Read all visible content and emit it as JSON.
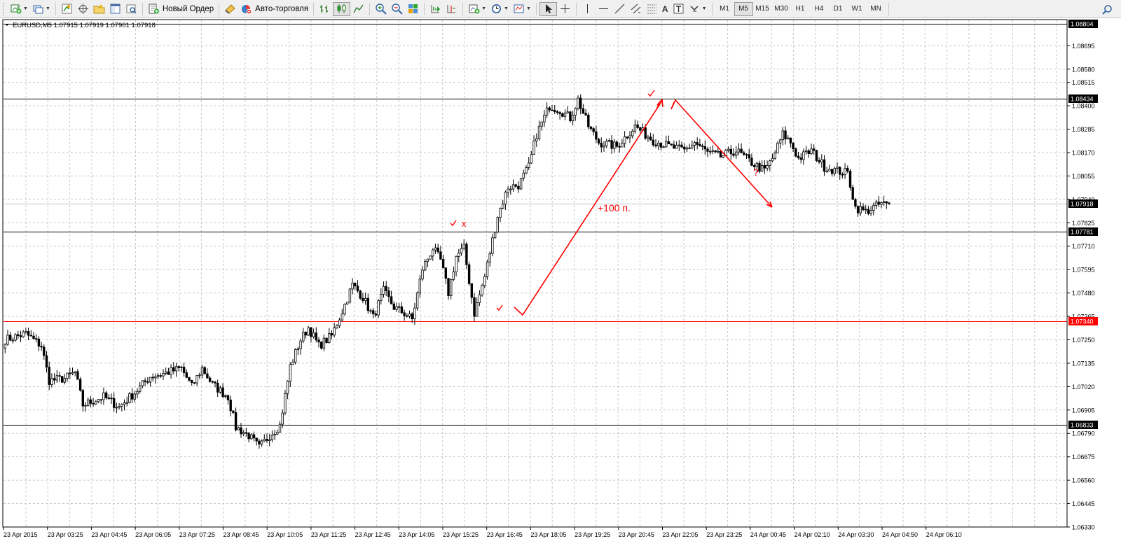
{
  "toolbar": {
    "new_order_label": "Новый Ордер",
    "auto_trading_label": "Авто-торговля",
    "timeframes": [
      "M1",
      "M5",
      "M15",
      "M30",
      "H1",
      "H4",
      "D1",
      "W1",
      "MN"
    ],
    "active_timeframe": "M5",
    "letter_tool": "A"
  },
  "chart_data": {
    "type": "candlestick",
    "symbol_info": "EURUSD,M5  1.07915 1.07919 1.07901 1.07918",
    "ylim": [
      1.0633,
      1.0882
    ],
    "price_ticks": [
      "1.08695",
      "1.08580",
      "1.08515",
      "1.08400",
      "1.08285",
      "1.08170",
      "1.08055",
      "1.07940",
      "1.07825",
      "1.07710",
      "1.07595",
      "1.07480",
      "1.07365",
      "1.07250",
      "1.07135",
      "1.07020",
      "1.06905",
      "1.06790",
      "1.06675",
      "1.06560",
      "1.06445",
      "1.06330"
    ],
    "time_labels": [
      "23 Apr 2015",
      "23 Apr 03:25",
      "23 Apr 04:45",
      "23 Apr 06:05",
      "23 Apr 07:25",
      "23 Apr 08:45",
      "23 Apr 10:05",
      "23 Apr 11:25",
      "23 Apr 12:45",
      "23 Apr 14:05",
      "23 Apr 15:25",
      "23 Apr 16:45",
      "23 Apr 18:05",
      "23 Apr 19:25",
      "23 Apr 20:45",
      "23 Apr 22:05",
      "23 Apr 23:25",
      "24 Apr 00:45",
      "24 Apr 02:10",
      "24 Apr 03:30",
      "24 Apr 04:50",
      "24 Apr 06:10"
    ],
    "close_anchors": [
      [
        0,
        1.0725
      ],
      [
        8,
        1.0728
      ],
      [
        14,
        1.0722
      ],
      [
        17,
        1.0705
      ],
      [
        23,
        1.0706
      ],
      [
        27,
        1.0709
      ],
      [
        30,
        1.0693
      ],
      [
        38,
        1.0697
      ],
      [
        44,
        1.0692
      ],
      [
        50,
        1.0699
      ],
      [
        56,
        1.0707
      ],
      [
        60,
        1.0708
      ],
      [
        68,
        1.0711
      ],
      [
        72,
        1.0702
      ],
      [
        76,
        1.0711
      ],
      [
        80,
        1.0703
      ],
      [
        86,
        1.0697
      ],
      [
        89,
        1.0682
      ],
      [
        94,
        1.0678
      ],
      [
        98,
        1.0672
      ],
      [
        102,
        1.0678
      ],
      [
        106,
        1.0683
      ],
      [
        110,
        1.0712
      ],
      [
        114,
        1.0725
      ],
      [
        117,
        1.0731
      ],
      [
        121,
        1.0722
      ],
      [
        126,
        1.0727
      ],
      [
        130,
        1.0739
      ],
      [
        134,
        1.0752
      ],
      [
        138,
        1.0746
      ],
      [
        142,
        1.0736
      ],
      [
        146,
        1.0749
      ],
      [
        150,
        1.0741
      ],
      [
        154,
        1.0738
      ],
      [
        157,
        1.0735
      ],
      [
        161,
        1.076
      ],
      [
        165,
        1.077
      ],
      [
        168,
        1.0764
      ],
      [
        171,
        1.0748
      ],
      [
        174,
        1.0766
      ],
      [
        177,
        1.077
      ],
      [
        181,
        1.0738
      ],
      [
        185,
        1.0756
      ],
      [
        190,
        1.0786
      ],
      [
        194,
        1.08
      ],
      [
        198,
        1.0801
      ],
      [
        202,
        1.081
      ],
      [
        205,
        1.0826
      ],
      [
        210,
        1.084
      ],
      [
        214,
        1.0838
      ],
      [
        218,
        1.0834
      ],
      [
        221,
        1.0843
      ],
      [
        225,
        1.083
      ],
      [
        229,
        1.0822
      ],
      [
        236,
        1.082
      ],
      [
        243,
        1.083
      ],
      [
        250,
        1.0823
      ],
      [
        256,
        1.082
      ],
      [
        262,
        1.0818
      ],
      [
        266,
        1.0822
      ],
      [
        271,
        1.0817
      ],
      [
        276,
        1.0815
      ],
      [
        282,
        1.0818
      ],
      [
        288,
        1.0812
      ],
      [
        293,
        1.0808
      ],
      [
        296,
        1.0814
      ],
      [
        300,
        1.0826
      ],
      [
        303,
        1.0822
      ],
      [
        306,
        1.0814
      ],
      [
        311,
        1.0818
      ],
      [
        316,
        1.081
      ],
      [
        321,
        1.0808
      ],
      [
        325,
        1.0807
      ],
      [
        328,
        1.079
      ],
      [
        332,
        1.0788
      ],
      [
        335,
        1.079
      ],
      [
        338,
        1.0792
      ],
      [
        341,
        1.0791
      ]
    ],
    "horizontal_levels": [
      {
        "price": 1.08804,
        "label": "1.08804",
        "color": "#000000"
      },
      {
        "price": 1.08434,
        "label": "1.08434",
        "color": "#000000"
      },
      {
        "price": 1.07918,
        "label": "1.07918",
        "color": "#c0c0c0"
      },
      {
        "price": 1.07781,
        "label": "1.07781",
        "color": "#000000"
      },
      {
        "price": 1.0734,
        "label": "1.07340",
        "color": "#ff0000"
      },
      {
        "price": 1.06833,
        "label": "1.06833",
        "color": "#000000"
      }
    ],
    "annotations": [
      "+100 п.",
      "?",
      "x"
    ],
    "grid": true
  }
}
